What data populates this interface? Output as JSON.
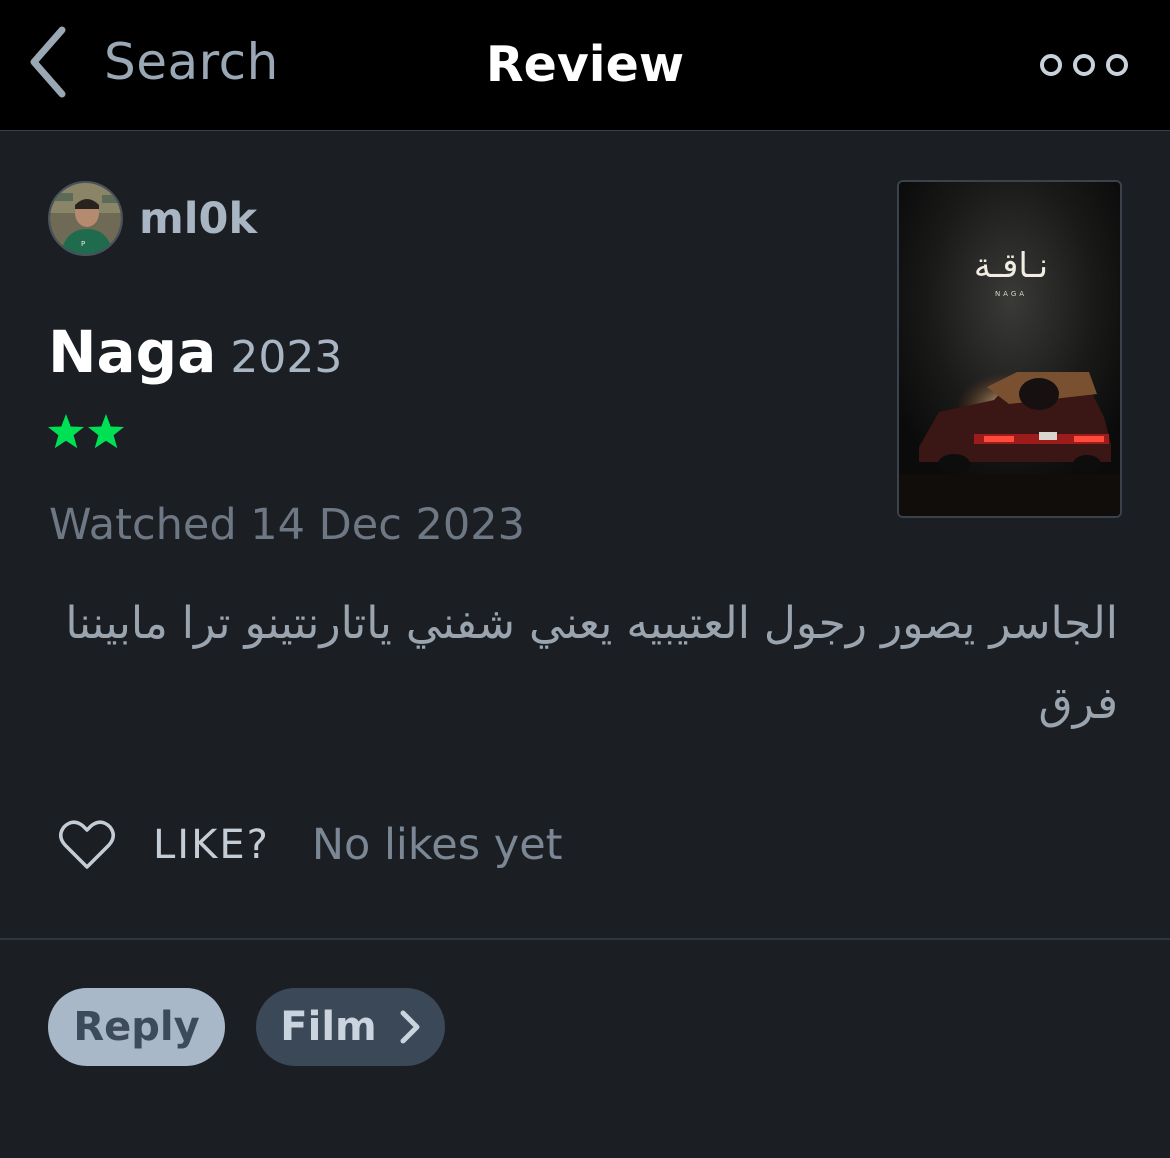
{
  "nav": {
    "back_label": "Search",
    "title": "Review"
  },
  "review": {
    "username": "ml0k",
    "film_title": "Naga",
    "film_year": "2023",
    "rating_stars": 2,
    "star_color": "#00e054",
    "watched": "Watched 14 Dec 2023",
    "text": "الجاسر يصور رجول العتيبيه يعني شفني ياتارنتينو ترا مابيننا فرق"
  },
  "poster": {
    "title_arabic": "نـاقـة",
    "title_latin": "NAGA"
  },
  "like": {
    "label": "LIKE?",
    "count_text": "No likes yet"
  },
  "actions": {
    "reply_label": "Reply",
    "film_label": "Film"
  }
}
